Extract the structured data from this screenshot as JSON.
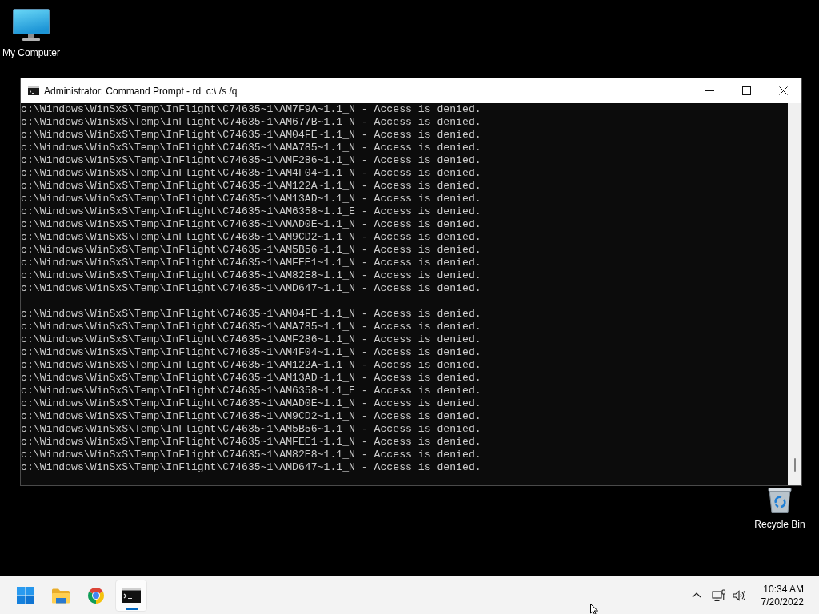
{
  "desktop": {
    "icons": [
      {
        "kind": "computer",
        "label": "My Computer"
      },
      {
        "kind": "recycle-bin",
        "label": "Recycle Bin"
      }
    ]
  },
  "window": {
    "title": "Administrator: Command Prompt - rd  c:\\ /s /q",
    "output": [
      [
        "c:\\Windows\\WinSxS\\Temp\\InFlight\\C74635~1\\AM7F9A~1.1_N - Access is denied.",
        "c:\\Windows\\WinSxS\\Temp\\InFlight\\C74635~1\\AM677B~1.1_N - Access is denied.",
        "c:\\Windows\\WinSxS\\Temp\\InFlight\\C74635~1\\AM04FE~1.1_N - Access is denied.",
        "c:\\Windows\\WinSxS\\Temp\\InFlight\\C74635~1\\AMA785~1.1_N - Access is denied.",
        "c:\\Windows\\WinSxS\\Temp\\InFlight\\C74635~1\\AMF286~1.1_N - Access is denied.",
        "c:\\Windows\\WinSxS\\Temp\\InFlight\\C74635~1\\AM4F04~1.1_N - Access is denied.",
        "c:\\Windows\\WinSxS\\Temp\\InFlight\\C74635~1\\AM122A~1.1_N - Access is denied.",
        "c:\\Windows\\WinSxS\\Temp\\InFlight\\C74635~1\\AM13AD~1.1_N - Access is denied.",
        "c:\\Windows\\WinSxS\\Temp\\InFlight\\C74635~1\\AM6358~1.1_E - Access is denied.",
        "c:\\Windows\\WinSxS\\Temp\\InFlight\\C74635~1\\AMAD0E~1.1_N - Access is denied.",
        "c:\\Windows\\WinSxS\\Temp\\InFlight\\C74635~1\\AM9CD2~1.1_N - Access is denied.",
        "c:\\Windows\\WinSxS\\Temp\\InFlight\\C74635~1\\AM5B56~1.1_N - Access is denied.",
        "c:\\Windows\\WinSxS\\Temp\\InFlight\\C74635~1\\AMFEE1~1.1_N - Access is denied.",
        "c:\\Windows\\WinSxS\\Temp\\InFlight\\C74635~1\\AM82E8~1.1_N - Access is denied.",
        "c:\\Windows\\WinSxS\\Temp\\InFlight\\C74635~1\\AMD647~1.1_N - Access is denied."
      ],
      [
        "c:\\Windows\\WinSxS\\Temp\\InFlight\\C74635~1\\AM04FE~1.1_N - Access is denied.",
        "c:\\Windows\\WinSxS\\Temp\\InFlight\\C74635~1\\AMA785~1.1_N - Access is denied.",
        "c:\\Windows\\WinSxS\\Temp\\InFlight\\C74635~1\\AMF286~1.1_N - Access is denied.",
        "c:\\Windows\\WinSxS\\Temp\\InFlight\\C74635~1\\AM4F04~1.1_N - Access is denied.",
        "c:\\Windows\\WinSxS\\Temp\\InFlight\\C74635~1\\AM122A~1.1_N - Access is denied.",
        "c:\\Windows\\WinSxS\\Temp\\InFlight\\C74635~1\\AM13AD~1.1_N - Access is denied.",
        "c:\\Windows\\WinSxS\\Temp\\InFlight\\C74635~1\\AM6358~1.1_E - Access is denied.",
        "c:\\Windows\\WinSxS\\Temp\\InFlight\\C74635~1\\AMAD0E~1.1_N - Access is denied.",
        "c:\\Windows\\WinSxS\\Temp\\InFlight\\C74635~1\\AM9CD2~1.1_N - Access is denied.",
        "c:\\Windows\\WinSxS\\Temp\\InFlight\\C74635~1\\AM5B56~1.1_N - Access is denied.",
        "c:\\Windows\\WinSxS\\Temp\\InFlight\\C74635~1\\AMFEE1~1.1_N - Access is denied.",
        "c:\\Windows\\WinSxS\\Temp\\InFlight\\C74635~1\\AM82E8~1.1_N - Access is denied.",
        "c:\\Windows\\WinSxS\\Temp\\InFlight\\C74635~1\\AMD647~1.1_N - Access is denied."
      ]
    ]
  },
  "taskbar": {
    "apps": [
      {
        "kind": "start",
        "active": false
      },
      {
        "kind": "folder",
        "active": false
      },
      {
        "kind": "browser",
        "active": false
      },
      {
        "kind": "terminal",
        "active": true
      }
    ],
    "tray": {
      "time": "10:34 AM",
      "date": "7/20/2022"
    }
  }
}
